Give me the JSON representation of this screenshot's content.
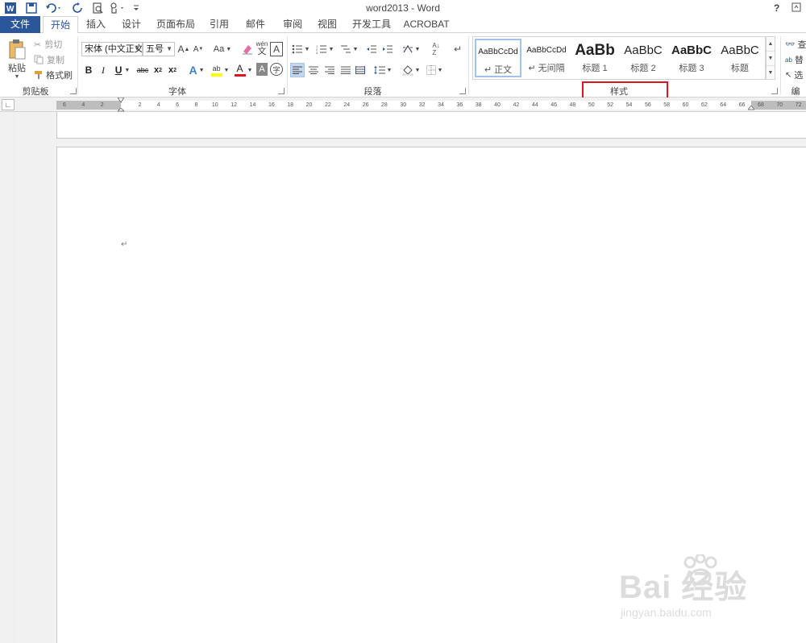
{
  "window": {
    "title": "word2013 - Word",
    "help": "?",
    "restore_icon": "ribbon-display-icon"
  },
  "quick_access": [
    "word-logo-icon",
    "save-icon",
    "undo-icon",
    "redo-icon",
    "print-preview-icon",
    "touch-mode-icon",
    "customize-qat-icon"
  ],
  "tabs": [
    {
      "label": "文件"
    },
    {
      "label": "开始"
    },
    {
      "label": "插入"
    },
    {
      "label": "设计"
    },
    {
      "label": "页面布局"
    },
    {
      "label": "引用"
    },
    {
      "label": "邮件"
    },
    {
      "label": "审阅"
    },
    {
      "label": "视图"
    },
    {
      "label": "开发工具"
    },
    {
      "label": "ACROBAT"
    }
  ],
  "clipboard": {
    "paste": "粘贴",
    "cut": "剪切",
    "copy": "复制",
    "format_painter": "格式刷",
    "group_label": "剪贴板"
  },
  "font": {
    "font_name": "宋体 (中文正文",
    "font_size": "五号",
    "grow": "A",
    "shrink": "A",
    "change_case": "Aa",
    "phonetic": "wén",
    "bold": "B",
    "italic": "I",
    "underline": "U",
    "strikethrough": "abc",
    "subscript": "x",
    "superscript": "x",
    "text_effects": "A",
    "highlight": "ab",
    "font_color": "A",
    "shading": "A",
    "enclose": "字",
    "group_label": "字体"
  },
  "paragraph": {
    "group_label": "段落"
  },
  "styles": {
    "items": [
      {
        "sample": "AaBbCcDd",
        "name": "↵ 正文"
      },
      {
        "sample": "AaBbCcDd",
        "name": "↵ 无间隔"
      },
      {
        "sample": "AaBb",
        "name": "标题 1"
      },
      {
        "sample": "AaBbC",
        "name": "标题 2"
      },
      {
        "sample": "AaBbC",
        "name": "标题 3"
      },
      {
        "sample": "AaBbC",
        "name": "标题"
      }
    ],
    "group_label": "样式"
  },
  "editing": {
    "find": "查",
    "replace": "替",
    "select": "选",
    "group_label": "编"
  },
  "ruler": {
    "labels": [
      "6",
      "4",
      "2",
      "2",
      "4",
      "6",
      "8",
      "10",
      "12",
      "14",
      "16",
      "18",
      "20",
      "22",
      "24",
      "26",
      "28",
      "30",
      "32",
      "34",
      "36",
      "38",
      "40",
      "42",
      "44",
      "46",
      "48",
      "50",
      "52",
      "54",
      "56",
      "58",
      "60",
      "62",
      "64",
      "66",
      "68",
      "70",
      "72"
    ]
  },
  "document": {
    "paragraph_mark": "↵"
  },
  "watermark": {
    "main": "Bai 经验",
    "sub": "jingyan.baidu.com"
  },
  "colors": {
    "accent": "#2b579a",
    "highlight_box": "#e0141e",
    "font_color_bar": "#e0141e",
    "highlight_bar": "#ffff00"
  }
}
